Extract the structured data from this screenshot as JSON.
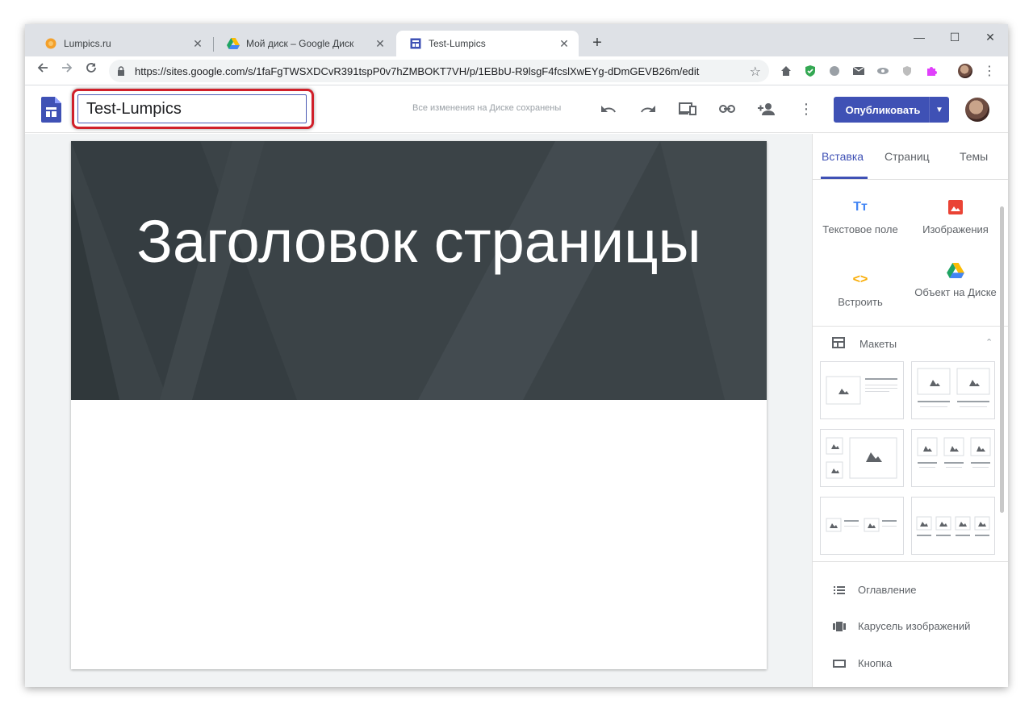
{
  "browser": {
    "tabs": [
      {
        "title": "Lumpics.ru",
        "icon": "orange-circle-icon"
      },
      {
        "title": "Мой диск – Google Диск",
        "icon": "google-drive-icon"
      },
      {
        "title": "Test-Lumpics",
        "icon": "sites-icon"
      }
    ],
    "url": "https://sites.google.com/s/1faFgTWSXDCvR391tspP0v7hZMBOKT7VH/p/1EBbU-R9lsgF4fcslXwEYg-dDmGEVB26m/edit"
  },
  "header": {
    "site_title": "Test-Lumpics",
    "save_status": "Все изменения на Диске сохранены",
    "publish_label": "Опубликовать"
  },
  "page": {
    "banner_title": "Заголовок страницы"
  },
  "panel": {
    "tabs": [
      "Вставка",
      "Страниц",
      "Темы"
    ],
    "insert_items": [
      "Текстовое поле",
      "Изображения",
      "Встроить",
      "Объект на Диске"
    ],
    "layouts_label": "Макеты",
    "components": [
      "Оглавление",
      "Карусель изображений",
      "Кнопка"
    ]
  },
  "colors": {
    "accent": "#3f51b5",
    "banner_bg": "#3b4347",
    "highlight": "#d0202a"
  }
}
